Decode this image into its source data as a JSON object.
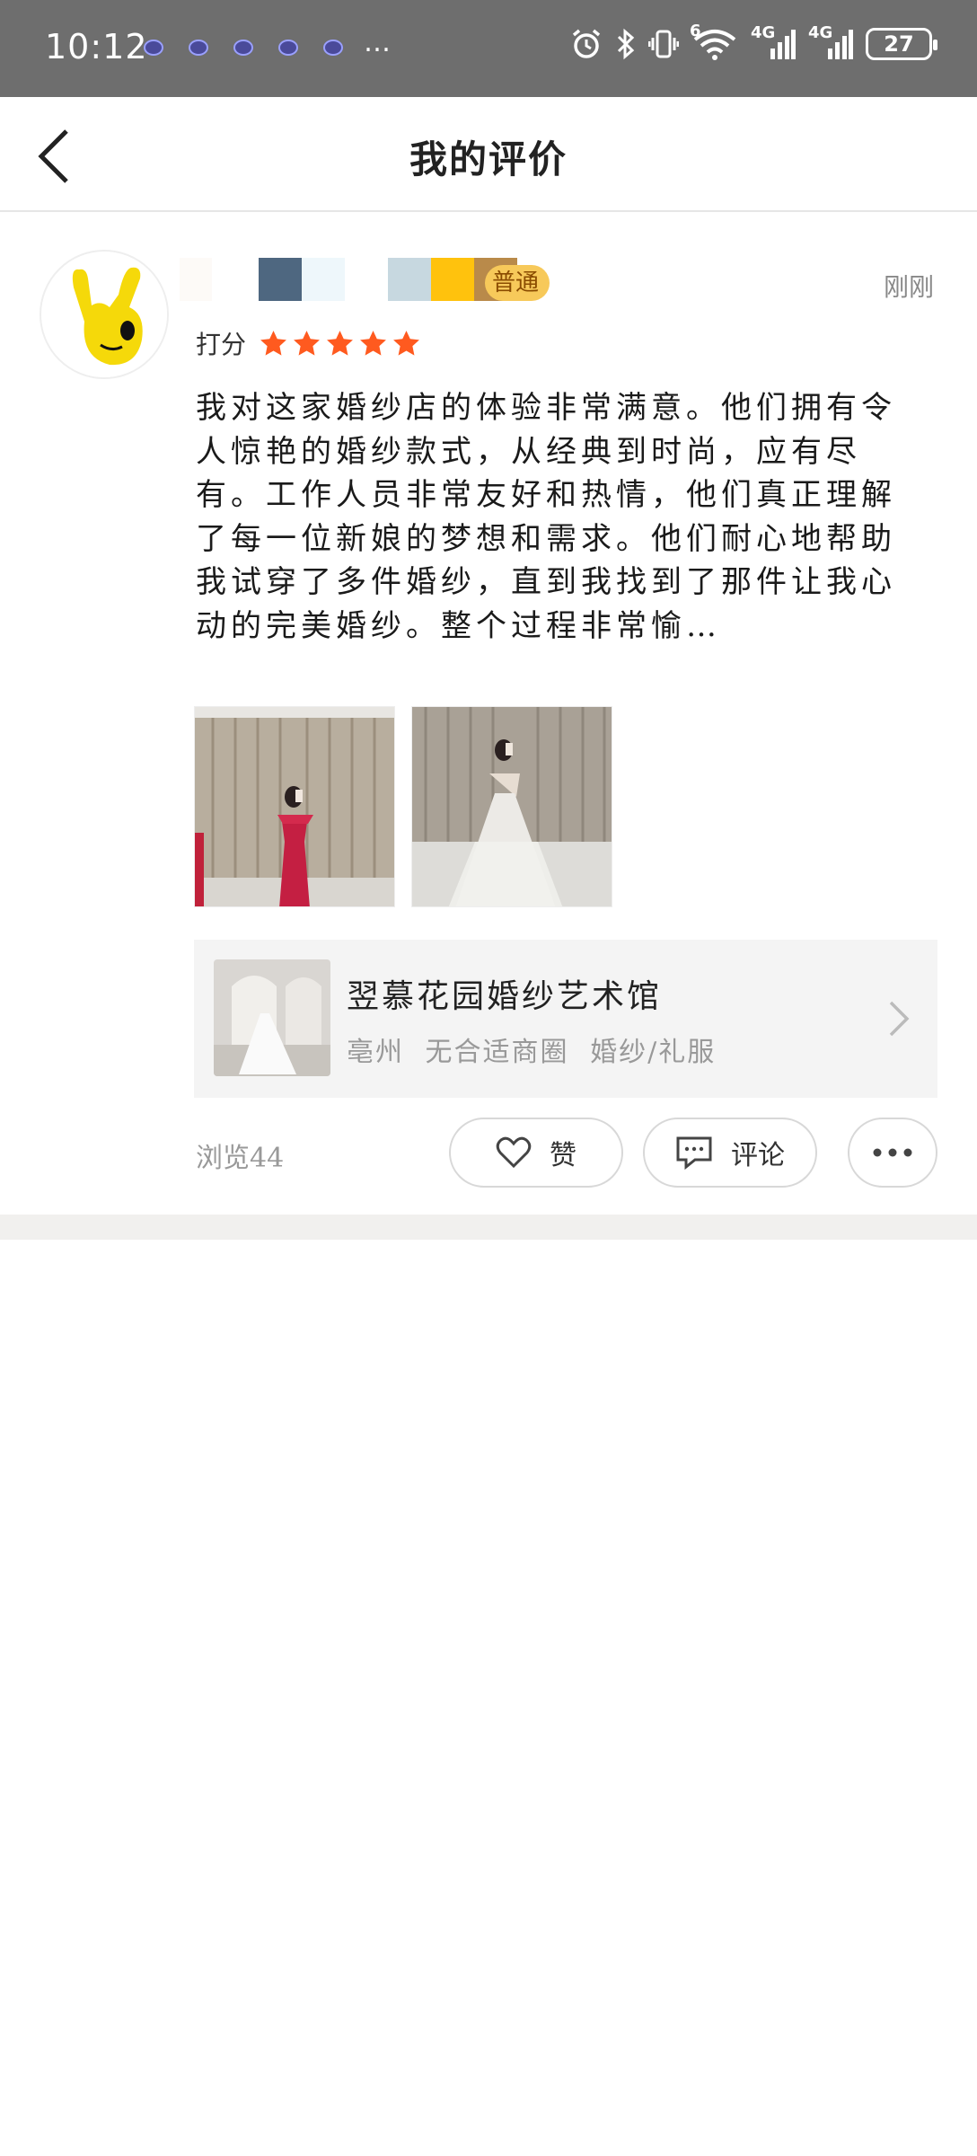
{
  "status_bar": {
    "time": "10:12",
    "more": "…",
    "network_labels": [
      "6",
      "4G",
      "4G"
    ],
    "battery": "27"
  },
  "header": {
    "title": "我的评价"
  },
  "review": {
    "level_badge": "普通",
    "time": "刚刚",
    "rating_label": "打分",
    "rating": 5,
    "rating_max": 5,
    "text": "我对这家婚纱店的体验非常满意。他们拥有令人惊艳的婚纱款式，从经典到时尚，应有尽有。工作人员非常友好和热情，他们真正理解了每一位新娘的梦想和需求。他们耐心地帮助我试穿了多件婚纱，直到我找到了那件让我心动的完美婚纱。整个过程非常愉…",
    "photos": [
      {
        "icon": "red-dress-photo"
      },
      {
        "icon": "white-gown-photo"
      }
    ]
  },
  "shop": {
    "name": "翌慕花园婚纱艺术馆",
    "location": "亳州",
    "district": "无合适商圈",
    "category": "婚纱/礼服"
  },
  "footer": {
    "views": "浏览44",
    "like_label": "赞",
    "comment_label": "评论"
  },
  "colors": {
    "status_bar_bg": "#6e6e6e",
    "star": "#ff5a1f",
    "badge_bg": "#f7c95a",
    "card_bg": "#f4f4f4"
  }
}
